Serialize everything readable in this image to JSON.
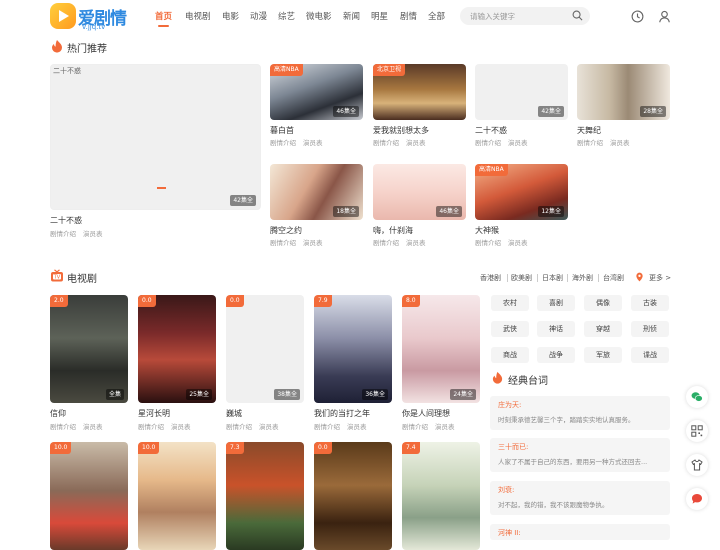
{
  "site": {
    "name": "爱剧情",
    "url": "v.jjq.tv"
  },
  "nav": [
    "首页",
    "电视剧",
    "电影",
    "动漫",
    "综艺",
    "微电影",
    "新闻",
    "明星",
    "剧情",
    "全部"
  ],
  "search": {
    "placeholder": "请输入关键字"
  },
  "hot": {
    "title": "热门推荐",
    "sub": [
      "剧情介绍",
      "演员表"
    ],
    "items": [
      {
        "title": "二十不惑",
        "alt": "二十不惑",
        "ep": "42集全",
        "badge": ""
      },
      {
        "title": "暮白首",
        "ep": "46集全",
        "badge": "高清NBA"
      },
      {
        "title": "爱我就别想太多",
        "ep": "",
        "badge": "北京卫视"
      },
      {
        "title": "二十不惑",
        "ep": "42集全",
        "badge": ""
      },
      {
        "title": "天舞纪",
        "ep": "28集全",
        "badge": ""
      },
      {
        "title": "腾空之约",
        "ep": "18集全",
        "badge": ""
      },
      {
        "title": "嗨，什刹海",
        "ep": "46集全",
        "badge": ""
      },
      {
        "title": "大神猴",
        "ep": "12集全",
        "badge": "高清NBA"
      }
    ]
  },
  "tv": {
    "title": "电视剧",
    "regions": [
      "香港剧",
      "欧美剧",
      "日本剧",
      "海外剧",
      "台湾剧"
    ],
    "more": "更多 >",
    "items": [
      {
        "title": "信仰",
        "ep": "全集",
        "badge": "2.0"
      },
      {
        "title": "星河长明",
        "ep": "25集全",
        "badge": "0.0"
      },
      {
        "title": "巍城",
        "ep": "38集全",
        "badge": "0.0"
      },
      {
        "title": "我们的当打之年",
        "ep": "36集全",
        "badge": "7.9"
      },
      {
        "title": "你是人间理想",
        "ep": "24集全",
        "badge": "8.0"
      },
      {
        "title": "",
        "ep": "",
        "badge": "10.0"
      },
      {
        "title": "",
        "ep": "",
        "badge": "10.0"
      },
      {
        "title": "",
        "ep": "",
        "badge": "7.3"
      },
      {
        "title": "",
        "ep": "",
        "badge": "0.0"
      },
      {
        "title": "",
        "ep": "",
        "badge": "7.4"
      }
    ],
    "tags": [
      "农村",
      "喜剧",
      "偶像",
      "古装",
      "武侠",
      "神话",
      "穿越",
      "刑侦",
      "商战",
      "战争",
      "军旅",
      "谍战"
    ]
  },
  "quotes": {
    "title": "经典台词",
    "items": [
      {
        "name": "庄为天:",
        "text": "时刻秉承德艺馨三个字，踏踏实实地认真服务。"
      },
      {
        "name": "三十而已:",
        "text": "人家了不属于自己的东西，要用另一种方式还回去..."
      },
      {
        "name": "刘衰:",
        "text": "对不起，我的错，我不该跟魔物争执。"
      },
      {
        "name": "河神 II:",
        "text": ""
      }
    ]
  },
  "colors": {
    "accent": "#f26b3a",
    "brand": "#2f8ae0"
  }
}
